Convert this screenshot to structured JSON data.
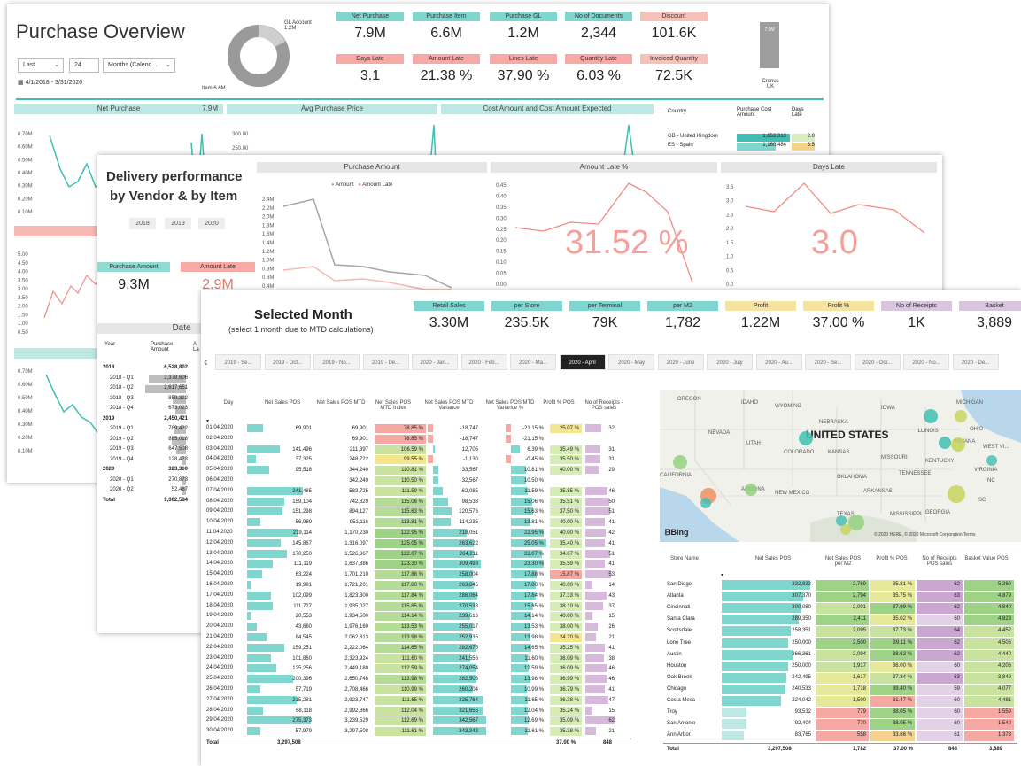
{
  "purchase": {
    "title": "Purchase Overview",
    "filter_period": "Last",
    "filter_count": "24",
    "filter_unit": "Months (Calend...",
    "date_range": "4/1/2018 - 3/31/2020",
    "donut_label_top": "GL Account",
    "donut_value_top": "1.2M",
    "donut_label_bottom": "Item 6.6M",
    "kpis": [
      {
        "label": "Net Purchase",
        "value": "7.9M",
        "color": "#7fd6cf"
      },
      {
        "label": "Purchase Item",
        "value": "6.6M",
        "color": "#7fd6cf"
      },
      {
        "label": "Purchase GL",
        "value": "1.2M",
        "color": "#7fd6cf"
      },
      {
        "label": "No of Documents",
        "value": "2,344",
        "color": "#7fd6cf"
      },
      {
        "label": "Discount",
        "value": "101.6K",
        "color": "#f7c1b8"
      },
      {
        "label": "Days Late",
        "value": "3.1",
        "color": "#f7a9a5"
      },
      {
        "label": "Amount Late",
        "value": "21.38 %",
        "color": "#f7a9a5"
      },
      {
        "label": "Lines Late",
        "value": "37.90 %",
        "color": "#f7a9a5"
      },
      {
        "label": "Quantity Late",
        "value": "6.03 %",
        "color": "#f7a9a5"
      },
      {
        "label": "Invoiced Quantity",
        "value": "72.5K",
        "color": "#f7c1b8"
      }
    ],
    "cronus_bar_value": "7.9M",
    "cronus_label": "Cronus",
    "cronus_sub": "UK",
    "chart_titles": [
      "Net Purchase",
      "Avg Purchase Price",
      "Cost Amount and Cost Amount Expected"
    ],
    "net_purchase_value": "7.9M",
    "net_purchase_ticks": [
      "0.70M",
      "0.60M",
      "0.50M",
      "0.40M",
      "0.30M",
      "0.20M",
      "0.10M"
    ],
    "avg_price_ticks": [
      "300.00",
      "250.00"
    ],
    "left_ticks2": [
      "5.00",
      "4.50",
      "4.00",
      "3.50",
      "3.00",
      "2.50",
      "2.00",
      "1.50",
      "1.00",
      "0.50"
    ],
    "left_ticks3": [
      "0.70M",
      "0.60M",
      "0.50M",
      "0.40M",
      "0.30M",
      "0.20M",
      "0.10M"
    ],
    "country_table": {
      "headers": [
        "Country",
        "Purchase Cost Amount",
        "Days Late"
      ],
      "rows": [
        [
          "GB - United Kingdom",
          "1,652,313",
          "2.0"
        ],
        [
          "ES - Spain",
          "1,160,484",
          "3.5"
        ]
      ]
    }
  },
  "delivery": {
    "title_line1": "Delivery performance",
    "title_line2": "by Vendor & by Item",
    "years": [
      "2018",
      "2019",
      "2020"
    ],
    "kpi1_label": "Purchase Amount",
    "kpi1_value": "9.3M",
    "kpi2_label": "Amount Late",
    "kpi2_value": "2.9M",
    "chart1_title": "Purchase Amount",
    "legend_amount": "Amount",
    "legend_late": "Amount Late",
    "chart1_ticks": [
      "2.4M",
      "2.2M",
      "2.0M",
      "1.8M",
      "1.6M",
      "1.4M",
      "1.2M",
      "1.0M",
      "0.8M",
      "0.6M",
      "0.4M"
    ],
    "chart2_title": "Amount Late %",
    "chart2_ticks": [
      "0.45",
      "0.40",
      "0.35",
      "0.30",
      "0.25",
      "0.20",
      "0.15",
      "0.10",
      "0.05",
      "0.00"
    ],
    "chart2_big": "31.52 %",
    "chart3_title": "Days Late",
    "chart3_ticks": [
      "3.5",
      "3.0",
      "2.5",
      "2.0",
      "1.5",
      "1.0",
      "0.5",
      "0.0"
    ],
    "chart3_big": "3.0",
    "date_header": "Date",
    "table_headers": [
      "Year",
      "Purchase Amount",
      "A La"
    ],
    "table_rows": [
      {
        "label": "2018",
        "value": "6,528,802",
        "bold": true
      },
      {
        "label": "2018 - Q1",
        "value": "2,378,606",
        "bold": false
      },
      {
        "label": "2018 - Q2",
        "value": "2,617,651",
        "bold": false
      },
      {
        "label": "2018 - Q3",
        "value": "859,322",
        "bold": false
      },
      {
        "label": "2018 - Q4",
        "value": "673,023",
        "bold": false
      },
      {
        "label": "2019",
        "value": "2,450,421",
        "bold": true
      },
      {
        "label": "2019 - Q1",
        "value": "789,422",
        "bold": false
      },
      {
        "label": "2019 - Q2",
        "value": "885,018",
        "bold": false
      },
      {
        "label": "2019 - Q3",
        "value": "647,508",
        "bold": false
      },
      {
        "label": "2019 - Q4",
        "value": "128,473",
        "bold": false
      },
      {
        "label": "2020",
        "value": "323,360",
        "bold": true
      },
      {
        "label": "2020 - Q1",
        "value": "270,873",
        "bold": false
      },
      {
        "label": "2020 - Q2",
        "value": "52,487",
        "bold": false
      },
      {
        "label": "Total",
        "value": "9,302,584",
        "bold": true
      }
    ]
  },
  "sales": {
    "title": "Selected Month",
    "subtitle": "(select 1 month due to MTD calculations)",
    "kpis": [
      {
        "label": "Retail Sales",
        "value": "3.30M",
        "color": "#7fd6cf"
      },
      {
        "label": "per Store",
        "value": "235.5K",
        "color": "#7fd6cf"
      },
      {
        "label": "per Terminal",
        "value": "79K",
        "color": "#7fd6cf"
      },
      {
        "label": "per M2",
        "value": "1,782",
        "color": "#7fd6cf"
      },
      {
        "label": "Profit",
        "value": "1.22M",
        "color": "#f7e3a0"
      },
      {
        "label": "Profit %",
        "value": "37.00 %",
        "color": "#f7e3a0"
      },
      {
        "label": "No of Receipts",
        "value": "1K",
        "color": "#d9c6de"
      },
      {
        "label": "Basket",
        "value": "3,889",
        "color": "#d9c6de"
      }
    ],
    "months": [
      "2019 - Se...",
      "2019 - Oct...",
      "2019 - No...",
      "2019 - De...",
      "2020 - Jan...",
      "2020 - Feb...",
      "2020 - Ma...",
      "2020 - April",
      "2020 - May",
      "2020 - June",
      "2020 - July",
      "2020 - Au...",
      "2020 - Se...",
      "2020 - Oct...",
      "2020 - No...",
      "2020 - De..."
    ],
    "selected_month": "2020 - April",
    "daily_headers": [
      "Day",
      "Net Sales POS",
      "Net Sales POS MTD",
      "Net Sales POS MTD Index",
      "Net Sales POS MTD Variance",
      "Net Sales POS MTD Variance %",
      "Profit % POS",
      "No of Receipts - POS sales"
    ],
    "daily_rows": [
      [
        "01.04.2020",
        "69,901",
        "69,901",
        "78.85 %",
        "-18,747",
        "-21.15 %",
        "25.07 %",
        "32"
      ],
      [
        "02.04.2020",
        "",
        "69,901",
        "78.85 %",
        "-18,747",
        "-21.15 %",
        "",
        ""
      ],
      [
        "03.04.2020",
        "141,496",
        "211,397",
        "106.59 %",
        "12,705",
        "6.39 %",
        "35.49 %",
        "31"
      ],
      [
        "04.04.2020",
        "37,325",
        "248,722",
        "99.55 %",
        "-1,130",
        "-0.45 %",
        "35.50 %",
        "31"
      ],
      [
        "05.04.2020",
        "95,518",
        "344,240",
        "110.81 %",
        "33,567",
        "10.81 %",
        "40.00 %",
        "29"
      ],
      [
        "06.04.2020",
        "",
        "342,240",
        "110.50 %",
        "32,567",
        "10.50 %",
        "",
        ""
      ],
      [
        "07.04.2020",
        "241,485",
        "583,725",
        "111.59 %",
        "62,085",
        "11.59 %",
        "35.85 %",
        "46"
      ],
      [
        "08.04.2020",
        "159,104",
        "742,829",
        "115.06 %",
        "98,538",
        "15.06 %",
        "35.51 %",
        "50"
      ],
      [
        "09.04.2020",
        "151,298",
        "894,127",
        "115.63 %",
        "120,576",
        "15.63 %",
        "37.50 %",
        "51"
      ],
      [
        "10.04.2020",
        "56,989",
        "951,116",
        "113.81 %",
        "114,235",
        "13.81 %",
        "40.00 %",
        "41"
      ],
      [
        "11.04.2020",
        "219,114",
        "1,170,230",
        "122.95 %",
        "218,051",
        "22.95 %",
        "40.00 %",
        "42"
      ],
      [
        "12.04.2020",
        "145,867",
        "1,316,097",
        "125.05 %",
        "263,622",
        "25.05 %",
        "35.40 %",
        "41"
      ],
      [
        "13.04.2020",
        "170,250",
        "1,526,367",
        "122.07 %",
        "264,211",
        "22.07 %",
        "34.67 %",
        "51"
      ],
      [
        "14.04.2020",
        "111,119",
        "1,637,886",
        "123.30 %",
        "309,498",
        "23.30 %",
        "35.59 %",
        "41"
      ],
      [
        "15.04.2020",
        "63,224",
        "1,701,210",
        "117.88 %",
        "258,004",
        "17.88 %",
        "15.87 %",
        "53"
      ],
      [
        "16.04.2020",
        "19,991",
        "1,721,201",
        "117.80 %",
        "263,845",
        "17.80 %",
        "40.00 %",
        "14"
      ],
      [
        "17.04.2020",
        "102,099",
        "1,823,300",
        "117.84 %",
        "286,064",
        "17.84 %",
        "37.33 %",
        "43"
      ],
      [
        "18.04.2020",
        "111,727",
        "1,935,027",
        "115.85 %",
        "270,533",
        "15.85 %",
        "38.10 %",
        "37"
      ],
      [
        "19.04.2020",
        "20,553",
        "1,934,500",
        "114.14 %",
        "239,616",
        "14.14 %",
        "40.00 %",
        "15"
      ],
      [
        "20.04.2020",
        "43,660",
        "1,976,160",
        "113.53 %",
        "255,017",
        "13.53 %",
        "38.00 %",
        "26"
      ],
      [
        "21.04.2020",
        "84,545",
        "2,062,813",
        "113.98 %",
        "252,935",
        "13.98 %",
        "24.20 %",
        "21"
      ],
      [
        "22.04.2020",
        "159,251",
        "2,222,064",
        "114.65 %",
        "282,675",
        "14.65 %",
        "35.25 %",
        "41"
      ],
      [
        "23.04.2020",
        "101,860",
        "2,323,924",
        "111.60 %",
        "241,556",
        "11.60 %",
        "36.09 %",
        "38"
      ],
      [
        "24.04.2020",
        "125,256",
        "2,449,180",
        "112.59 %",
        "274,054",
        "12.59 %",
        "36.09 %",
        "46"
      ],
      [
        "25.04.2020",
        "200,396",
        "2,650,748",
        "113.98 %",
        "282,503",
        "13.98 %",
        "36.99 %",
        "46"
      ],
      [
        "26.04.2020",
        "57,719",
        "2,708,466",
        "110.99 %",
        "260,204",
        "10.99 %",
        "36.79 %",
        "41"
      ],
      [
        "27.04.2020",
        "215,281",
        "2,923,747",
        "111.65 %",
        "325,764",
        "11.65 %",
        "36.38 %",
        "47"
      ],
      [
        "28.04.2020",
        "68,118",
        "2,992,866",
        "112.04 %",
        "321,655",
        "12.04 %",
        "35.24 %",
        "15"
      ],
      [
        "29.04.2020",
        "275,373",
        "3,239,529",
        "112.69 %",
        "342,567",
        "12.69 %",
        "35.09 %",
        "62"
      ],
      [
        "30.04.2020",
        "57,979",
        "3,297,508",
        "111.61 %",
        "343,343",
        "11.61 %",
        "35.38 %",
        "21"
      ]
    ],
    "daily_total_label": "Total",
    "daily_total_sales": "3,297,508",
    "daily_total_profit": "37.00 %",
    "daily_total_receipts": "848",
    "map_title": "UNITED STATES",
    "map_states": [
      "OREGON",
      "IDAHO",
      "WYOMING",
      "IOWA",
      "MICHIGAN",
      "NEVADA",
      "UTAH",
      "NEBRASKA",
      "ILLINOIS",
      "INDIANA",
      "OHIO",
      "COLORADO",
      "KANSAS",
      "MISSOURI",
      "KENTUCKY",
      "WEST VI...",
      "CALIFORNIA",
      "OKLAHOMA",
      "TENNESSEE",
      "VIRGINIA",
      "NC",
      "ARIZONA",
      "NEW MEXICO",
      "ARKANSAS",
      "SC",
      "TEXAS",
      "MISSISSIPPI",
      "GEORGIA"
    ],
    "map_logo": "Bing",
    "map_copyright": "© 2020 HERE, © 2020 Microsoft Corporation Terms",
    "store_headers": [
      "Store Name",
      "Net Sales POS",
      "Net Sales POS per M2",
      "Profit % POS",
      "No of Receipts POS sales",
      "Basket Value POS"
    ],
    "store_rows": [
      [
        "San Diego",
        "332,833",
        "2,769",
        "35.81 %",
        "62",
        "5,360"
      ],
      [
        "Atlanta",
        "307,370",
        "2,794",
        "35.75 %",
        "63",
        "4,879"
      ],
      [
        "Cincinnati",
        "300,080",
        "2,001",
        "37.99 %",
        "62",
        "4,840"
      ],
      [
        "Santa Clara",
        "289,350",
        "2,411",
        "35.02 %",
        "60",
        "4,823"
      ],
      [
        "Scottsdale",
        "258,351",
        "2,095",
        "37.73 %",
        "64",
        "4,452"
      ],
      [
        "Lone Tree",
        "250,000",
        "2,500",
        "39.11 %",
        "62",
        "4,506"
      ],
      [
        "Austin",
        "266,361",
        "2,094",
        "38.62 %",
        "62",
        "4,440"
      ],
      [
        "Houston",
        "250,000",
        "1,917",
        "36.00 %",
        "60",
        "4,206"
      ],
      [
        "Oak Brook",
        "242,495",
        "1,617",
        "37.34 %",
        "63",
        "3,849"
      ],
      [
        "Chicago",
        "240,533",
        "1,718",
        "39.40 %",
        "59",
        "4,077"
      ],
      [
        "Costa Mesa",
        "224,042",
        "1,500",
        "31.47 %",
        "60",
        "4,481"
      ],
      [
        "Troy",
        "93,532",
        "779",
        "38.05 %",
        "60",
        "1,559"
      ],
      [
        "San Antonio",
        "92,404",
        "770",
        "38.05 %",
        "60",
        "1,540"
      ],
      [
        "Ann Arbor",
        "83,765",
        "558",
        "33.66 %",
        "61",
        "1,373"
      ]
    ],
    "store_total_label": "Total",
    "store_total": [
      "3,297,508",
      "1,782",
      "37.00 %",
      "848",
      "3,889"
    ]
  },
  "colors": {
    "teal": "#7fd6cf",
    "teal_dark": "#3fbfb3",
    "salmon": "#f28b82",
    "red_big": "#f4a09a",
    "yellow": "#f5e58c",
    "purple": "#d7b9dc"
  }
}
